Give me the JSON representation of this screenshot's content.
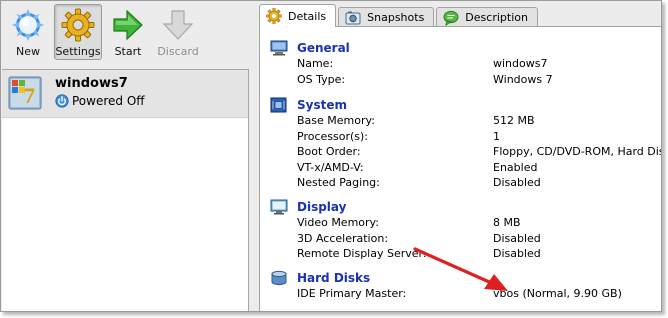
{
  "toolbar": {
    "new_label": "New",
    "settings_label": "Settings",
    "start_label": "Start",
    "discard_label": "Discard"
  },
  "vm_list": [
    {
      "name": "windows7",
      "status": "Powered Off"
    }
  ],
  "tabs": [
    {
      "label": "Details",
      "active": true
    },
    {
      "label": "Snapshots",
      "active": false
    },
    {
      "label": "Description",
      "active": false
    }
  ],
  "details": {
    "general": {
      "title": "General",
      "rows": [
        {
          "key": "Name:",
          "value": "windows7"
        },
        {
          "key": "OS Type:",
          "value": "Windows 7"
        }
      ]
    },
    "system": {
      "title": "System",
      "rows": [
        {
          "key": "Base Memory:",
          "value": "512 MB"
        },
        {
          "key": "Processor(s):",
          "value": "1"
        },
        {
          "key": "Boot Order:",
          "value": "Floppy, CD/DVD-ROM, Hard Disk"
        },
        {
          "key": "VT-x/AMD-V:",
          "value": "Enabled"
        },
        {
          "key": "Nested Paging:",
          "value": "Disabled"
        }
      ]
    },
    "display": {
      "title": "Display",
      "rows": [
        {
          "key": "Video Memory:",
          "value": "8 MB"
        },
        {
          "key": "3D Acceleration:",
          "value": "Disabled"
        },
        {
          "key": "Remote Display Server:",
          "value": "Disabled"
        }
      ]
    },
    "hard_disks": {
      "title": "Hard Disks",
      "rows": [
        {
          "key": "IDE Primary Master:",
          "value": "vbos (Normal, 9.90 GB)"
        }
      ]
    }
  },
  "colors": {
    "section_title": "#1a33b0",
    "annotation_arrow": "#e02020",
    "selected_row": "#e4e4e4"
  },
  "icons": {
    "new": "new-sun-icon",
    "settings": "gear-icon",
    "start": "green-arrow-icon",
    "discard": "down-arrow-icon",
    "vm_os": "windows7-os-icon",
    "status": "power-off-icon"
  }
}
